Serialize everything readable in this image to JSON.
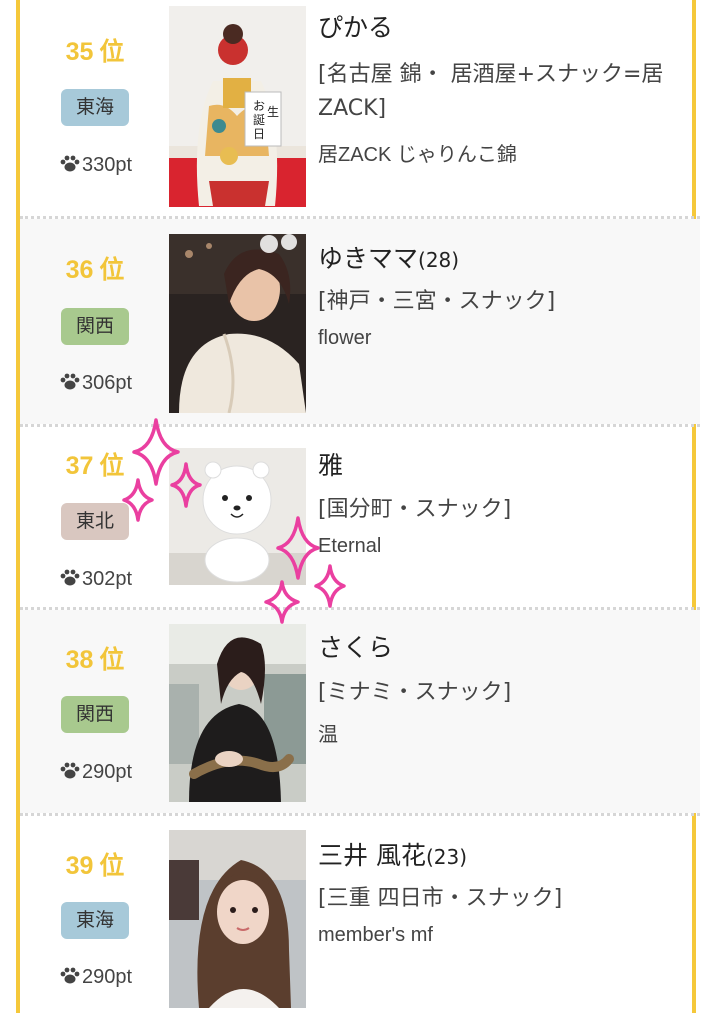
{
  "colors": {
    "frame": "#f5c83a",
    "rank": "#f2c53a",
    "badge_tokai": "#a7c9d9",
    "badge_kansai": "#a8c98e",
    "badge_tohoku": "#d9c7c0",
    "sparkle": "#ea3fa0"
  },
  "entries": [
    {
      "rank": "35",
      "rank_unit": "位",
      "region": "東海",
      "points": "330pt",
      "name": "ぴかる",
      "age": "",
      "area": "[名古屋 錦・ 居酒屋+スナック=居ZACK]",
      "shop": "居ZACK じゃりんこ錦",
      "photo_icon": "kimono-birthday-photo"
    },
    {
      "rank": "36",
      "rank_unit": "位",
      "region": "関西",
      "points": "306pt",
      "name": "ゆきママ",
      "age": "(28)",
      "area": "[神戸・三宮・スナック]",
      "shop": "flower",
      "photo_icon": "woman-selfie-photo"
    },
    {
      "rank": "37",
      "rank_unit": "位",
      "region": "東北",
      "points": "302pt",
      "name": "雅",
      "age": "",
      "area": "[国分町・スナック]",
      "shop": "Eternal",
      "photo_icon": "bear-plush-photo"
    },
    {
      "rank": "38",
      "rank_unit": "位",
      "region": "関西",
      "points": "290pt",
      "name": "さくら",
      "age": "",
      "area": "[ミナミ・スナック]",
      "shop": "温",
      "photo_icon": "woman-with-lizard-photo"
    },
    {
      "rank": "39",
      "rank_unit": "位",
      "region": "東海",
      "points": "290pt",
      "name": "三井 風花",
      "age": "(23)",
      "area": "[三重 四日市・スナック]",
      "shop": "member's mf",
      "photo_icon": "woman-portrait-photo"
    }
  ]
}
